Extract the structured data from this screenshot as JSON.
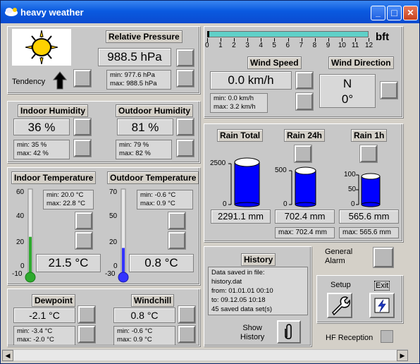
{
  "window": {
    "title": "heavy weather",
    "minimize": "_",
    "maximize": "□",
    "close": "✕"
  },
  "pressure": {
    "label": "Relative Pressure",
    "value": "988.5 hPa",
    "min": "min: 977.6 hPa",
    "max": "max: 988.5 hPa",
    "tendency_label": "Tendency"
  },
  "wind": {
    "scale_unit": "bft",
    "scale_ticks": [
      "0",
      "1",
      "2",
      "3",
      "4",
      "5",
      "6",
      "7",
      "8",
      "9",
      "10",
      "11",
      "12"
    ],
    "speed_label": "Wind Speed",
    "speed_value": "0.0 km/h",
    "min": "min: 0.0 km/h",
    "max": "max: 3.2 km/h",
    "direction_label": "Wind Direction",
    "direction": "N",
    "direction_deg": "0°"
  },
  "humidity": {
    "indoor_label": "Indoor Humidity",
    "indoor_value": "36 %",
    "indoor_min": "min: 35 %",
    "indoor_max": "max: 42 %",
    "outdoor_label": "Outdoor Humidity",
    "outdoor_value": "81 %",
    "outdoor_min": "min: 79 %",
    "outdoor_max": "max: 82 %"
  },
  "rain": {
    "total_label": "Rain Total",
    "r24_label": "Rain 24h",
    "r1_label": "Rain 1h",
    "total_value": "2291.1 mm",
    "r24_value": "702.4 mm",
    "r1_value": "565.6 mm",
    "r24_max": "max: 702.4 mm",
    "r1_max": "max: 565.6 mm",
    "total_ticks": [
      "2500",
      "0"
    ],
    "r24_ticks": [
      "500",
      "0"
    ],
    "r1_ticks": [
      "100",
      "50",
      "0"
    ]
  },
  "temperature": {
    "indoor_label": "Indoor Temperature",
    "indoor_min": "min: 20.0 °C",
    "indoor_max": "max: 22.8 °C",
    "indoor_value": "21.5 °C",
    "outdoor_label": "Outdoor Temperature",
    "outdoor_min": "min: -0.6 °C",
    "outdoor_max": "max: 0.9 °C",
    "outdoor_value": "0.8 °C",
    "indoor_ticks": [
      "60",
      "40",
      "20",
      "0",
      "-10"
    ],
    "outdoor_ticks": [
      "70",
      "50",
      "20",
      "0",
      "-30"
    ],
    "indoor_fill_level": 0.44,
    "outdoor_fill_level": 0.31
  },
  "history": {
    "label": "History",
    "saved_in": "Data saved in file:",
    "file": "history.dat",
    "from": "from: 01.01.01 00:10",
    "to": "to:      09.12.05 10:18",
    "count": "45 saved data set(s)",
    "show_label_1": "Show",
    "show_label_2": "History"
  },
  "alarm": {
    "line1": "General",
    "line2": "Alarm"
  },
  "setup": {
    "label": "Setup",
    "exit_label": "Exit"
  },
  "dewpoint": {
    "label": "Dewpoint",
    "value": "-2.1 °C",
    "min": "min: -3.4 °C",
    "max": "max: -2.0 °C"
  },
  "windchill": {
    "label": "Windchill",
    "value": "0.8 °C",
    "min": "min: -0.6 °C",
    "max": "max: 0.9 °C"
  },
  "hf": {
    "label": "HF Reception"
  },
  "colors": {
    "accent": "#0000ff",
    "green": "#2eaa2e",
    "title": "#0a5ae0",
    "windbar": "#5fd0c8"
  },
  "icons": [
    "sun-icon",
    "tendency-up-arrow-icon",
    "paperclip-icon",
    "wrench-icon",
    "lightning-exit-icon"
  ]
}
